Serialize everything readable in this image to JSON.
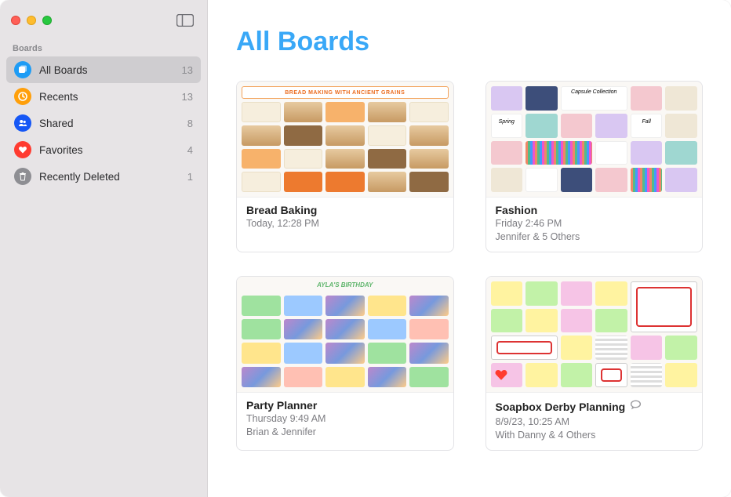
{
  "sidebar": {
    "section_title": "Boards",
    "items": [
      {
        "label": "All Boards",
        "count": "13"
      },
      {
        "label": "Recents",
        "count": "13"
      },
      {
        "label": "Shared",
        "count": "8"
      },
      {
        "label": "Favorites",
        "count": "4"
      },
      {
        "label": "Recently Deleted",
        "count": "1"
      }
    ]
  },
  "main": {
    "title": "All Boards",
    "boards": [
      {
        "name": "Bread Baking",
        "time": "Today, 12:28 PM",
        "people": "",
        "thumb_title": "BREAD MAKING WITH ANCIENT GRAINS"
      },
      {
        "name": "Fashion",
        "time": "Friday 2:46 PM",
        "people": "Jennifer & 5 Others",
        "thumb_labels": {
          "a": "Capsule Collection",
          "b": "Spring",
          "c": "Fall"
        }
      },
      {
        "name": "Party Planner",
        "time": "Thursday 9:49 AM",
        "people": "Brian & Jennifer",
        "thumb_title": "AYLA'S BIRTHDAY"
      },
      {
        "name": "Soapbox Derby Planning",
        "time": "8/9/23, 10:25 AM",
        "people": "With Danny & 4 Others",
        "favorited": true,
        "has_comments": true
      }
    ]
  }
}
